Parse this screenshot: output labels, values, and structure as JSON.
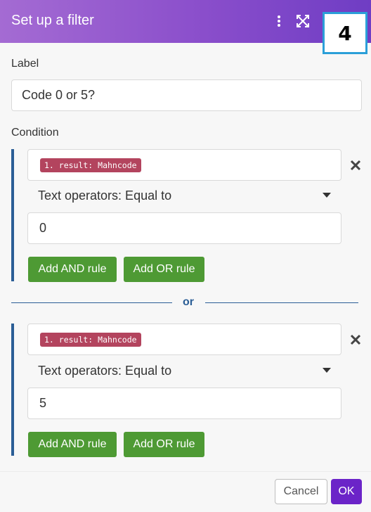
{
  "header": {
    "title": "Set up a filter",
    "badge": "4",
    "accent_color": "#8a4ecb"
  },
  "label_field": {
    "label": "Label",
    "value": "Code 0 or 5?"
  },
  "condition": {
    "label": "Condition",
    "groups": [
      {
        "operand": "1. result: Mahncode",
        "operator": "Text operators: Equal to",
        "value": "0",
        "add_and": "Add AND rule",
        "add_or": "Add OR rule"
      },
      {
        "operand": "1. result: Mahncode",
        "operator": "Text operators: Equal to",
        "value": "5",
        "add_and": "Add AND rule",
        "add_or": "Add OR rule"
      }
    ],
    "or_separator": "or"
  },
  "footer": {
    "cancel": "Cancel",
    "ok": "OK"
  },
  "icons": [
    "more-vertical-icon",
    "expand-icon",
    "close-icon",
    "caret-down-icon"
  ]
}
